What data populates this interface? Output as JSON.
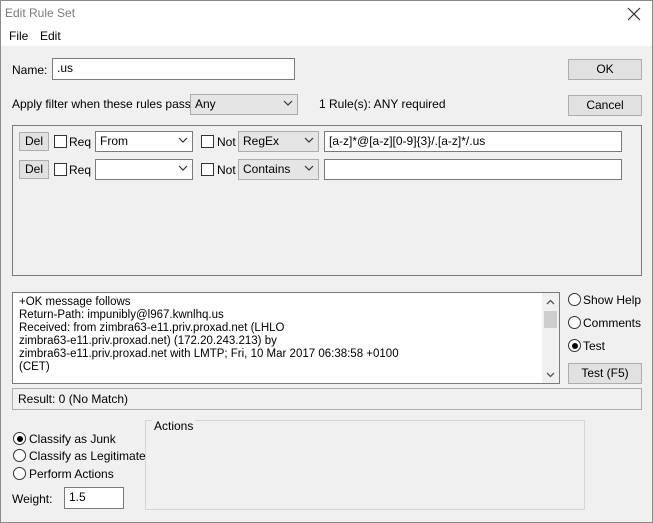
{
  "window": {
    "title": "Edit Rule Set"
  },
  "menu": {
    "file": "File",
    "edit": "Edit"
  },
  "name": {
    "label": "Name:",
    "value": ".us"
  },
  "filter": {
    "label": "Apply filter when these rules pass:",
    "mode": "Any",
    "required_text": "1 Rule(s): ANY required"
  },
  "buttons": {
    "ok": "OK",
    "cancel": "Cancel",
    "test": "Test (F5)"
  },
  "rules": [
    {
      "del": "Del",
      "req": "Req",
      "field": "From",
      "not": "Not",
      "operator": "RegEx",
      "value": "[a-z]*@[a-z][0-9]{3}/.[a-z]*/.us"
    },
    {
      "del": "Del",
      "req": "Req",
      "field": "",
      "not": "Not",
      "operator": "Contains",
      "value": ""
    }
  ],
  "message_lines": [
    "+OK message follows",
    "Return-Path: impunibly@l967.kwnlhq.us",
    "Received: from zimbra63-e11.priv.proxad.net (LHLO",
    " zimbra63-e11.priv.proxad.net) (172.20.243.213) by",
    " zimbra63-e11.priv.proxad.net with LMTP; Fri, 10 Mar 2017 06:38:58 +0100",
    " (CET)"
  ],
  "view_options": {
    "show_help": "Show Help",
    "comments": "Comments",
    "test": "Test"
  },
  "result": "Result: 0 (No Match)",
  "classify": {
    "junk": "Classify as Junk",
    "legitimate": "Classify as Legitimate",
    "perform_actions": "Perform Actions"
  },
  "weight": {
    "label": "Weight:",
    "value": "1.5"
  },
  "actions": {
    "legend": "Actions"
  }
}
